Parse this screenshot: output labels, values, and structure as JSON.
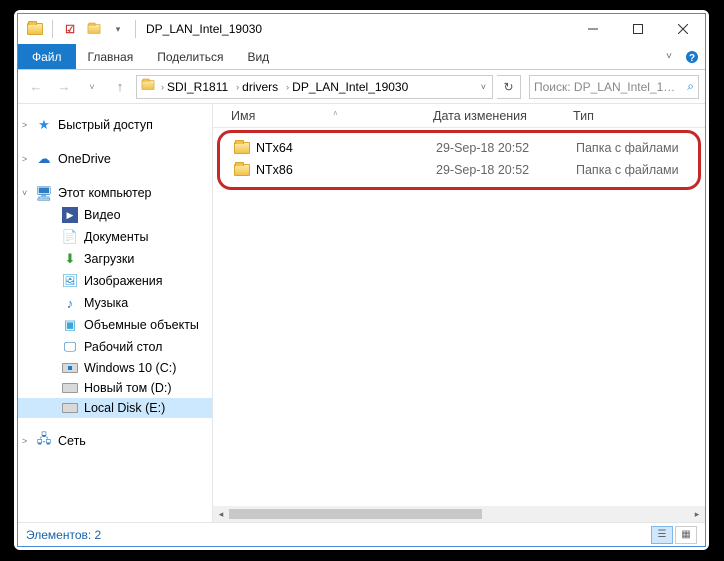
{
  "title": "DP_LAN_Intel_19030",
  "ribbon": {
    "file": "Файл",
    "home": "Главная",
    "share": "Поделиться",
    "view": "Вид"
  },
  "breadcrumbs": [
    "SDI_R1811",
    "drivers",
    "DP_LAN_Intel_19030"
  ],
  "search_placeholder": "Поиск: DP_LAN_Intel_1…",
  "columns": {
    "name": "Имя",
    "date": "Дата изменения",
    "type": "Тип"
  },
  "rows": [
    {
      "name": "NTx64",
      "date": "29-Sep-18 20:52",
      "type": "Папка с файлами"
    },
    {
      "name": "NTx86",
      "date": "29-Sep-18 20:52",
      "type": "Папка с файлами"
    }
  ],
  "nav": {
    "quick": "Быстрый доступ",
    "onedrive": "OneDrive",
    "thispc": "Этот компьютер",
    "items": [
      "Видео",
      "Документы",
      "Загрузки",
      "Изображения",
      "Музыка",
      "Объемные объекты",
      "Рабочий стол",
      "Windows 10 (C:)",
      "Новый том (D:)",
      "Local Disk (E:)"
    ],
    "network": "Сеть"
  },
  "status": "Элементов: 2"
}
